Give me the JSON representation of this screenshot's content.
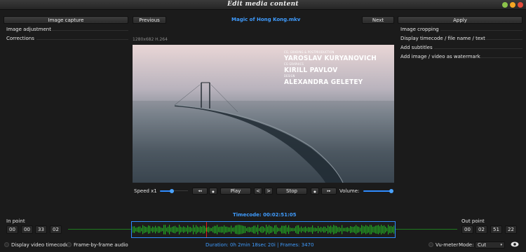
{
  "window": {
    "title": "Edit media content"
  },
  "toolbar": {
    "image_capture": "Image capture",
    "previous": "Previous",
    "file_name": "Magic of Hong Kong.mkv",
    "next": "Next",
    "apply": "Apply"
  },
  "left_panel": {
    "items": [
      "Image adjustment",
      "Corrections"
    ]
  },
  "right_panel": {
    "items": [
      "Image cropping",
      "Display timecode / file name / text",
      "Add subtitles",
      "Add image / video as watermark"
    ]
  },
  "video": {
    "info": "1280x682 H.264",
    "credits": [
      {
        "role": "CG, GRADING & POSTPRODUCTION",
        "name": "YAROSLAV KURYANOVICH"
      },
      {
        "role": "CG GRAPHICS",
        "name": "KIRILL PAVLOV"
      },
      {
        "role": "DESIGN",
        "name": "ALEXANDRA GELETEY"
      }
    ]
  },
  "controls": {
    "speed_label": "Speed x1",
    "speed_level": 0.5,
    "rewind_label": "◂◂",
    "step_back_label": "●",
    "play_label": "Play",
    "prev_frame_label": "<",
    "next_frame_label": ">",
    "stop_label": "Stop",
    "step_fwd_label": "●",
    "fast_fwd_label": "▸▸",
    "volume_label": "Volume:",
    "volume_level": 1.0
  },
  "timeline": {
    "timecode": "Timecode: 00:02:51:05",
    "in_point": {
      "label": "In point",
      "values": [
        "00",
        "00",
        "33",
        "02"
      ]
    },
    "out_point": {
      "label": "Out point",
      "values": [
        "00",
        "02",
        "51",
        "22"
      ]
    },
    "duration": "Duration: 0h 2min 18sec 20i | Frames: 3470"
  },
  "footer": {
    "display_timecode": "Display video timecode",
    "frame_audio": "Frame-by-frame audio",
    "vu_meter": "Vu-meter",
    "mode_label": "Mode:",
    "mode_value": "Cut"
  },
  "colors": {
    "accent": "#2f8cff",
    "waveform": "#22a822",
    "playhead": "#e01c1c"
  },
  "icons": {
    "eye": "eye-icon"
  }
}
